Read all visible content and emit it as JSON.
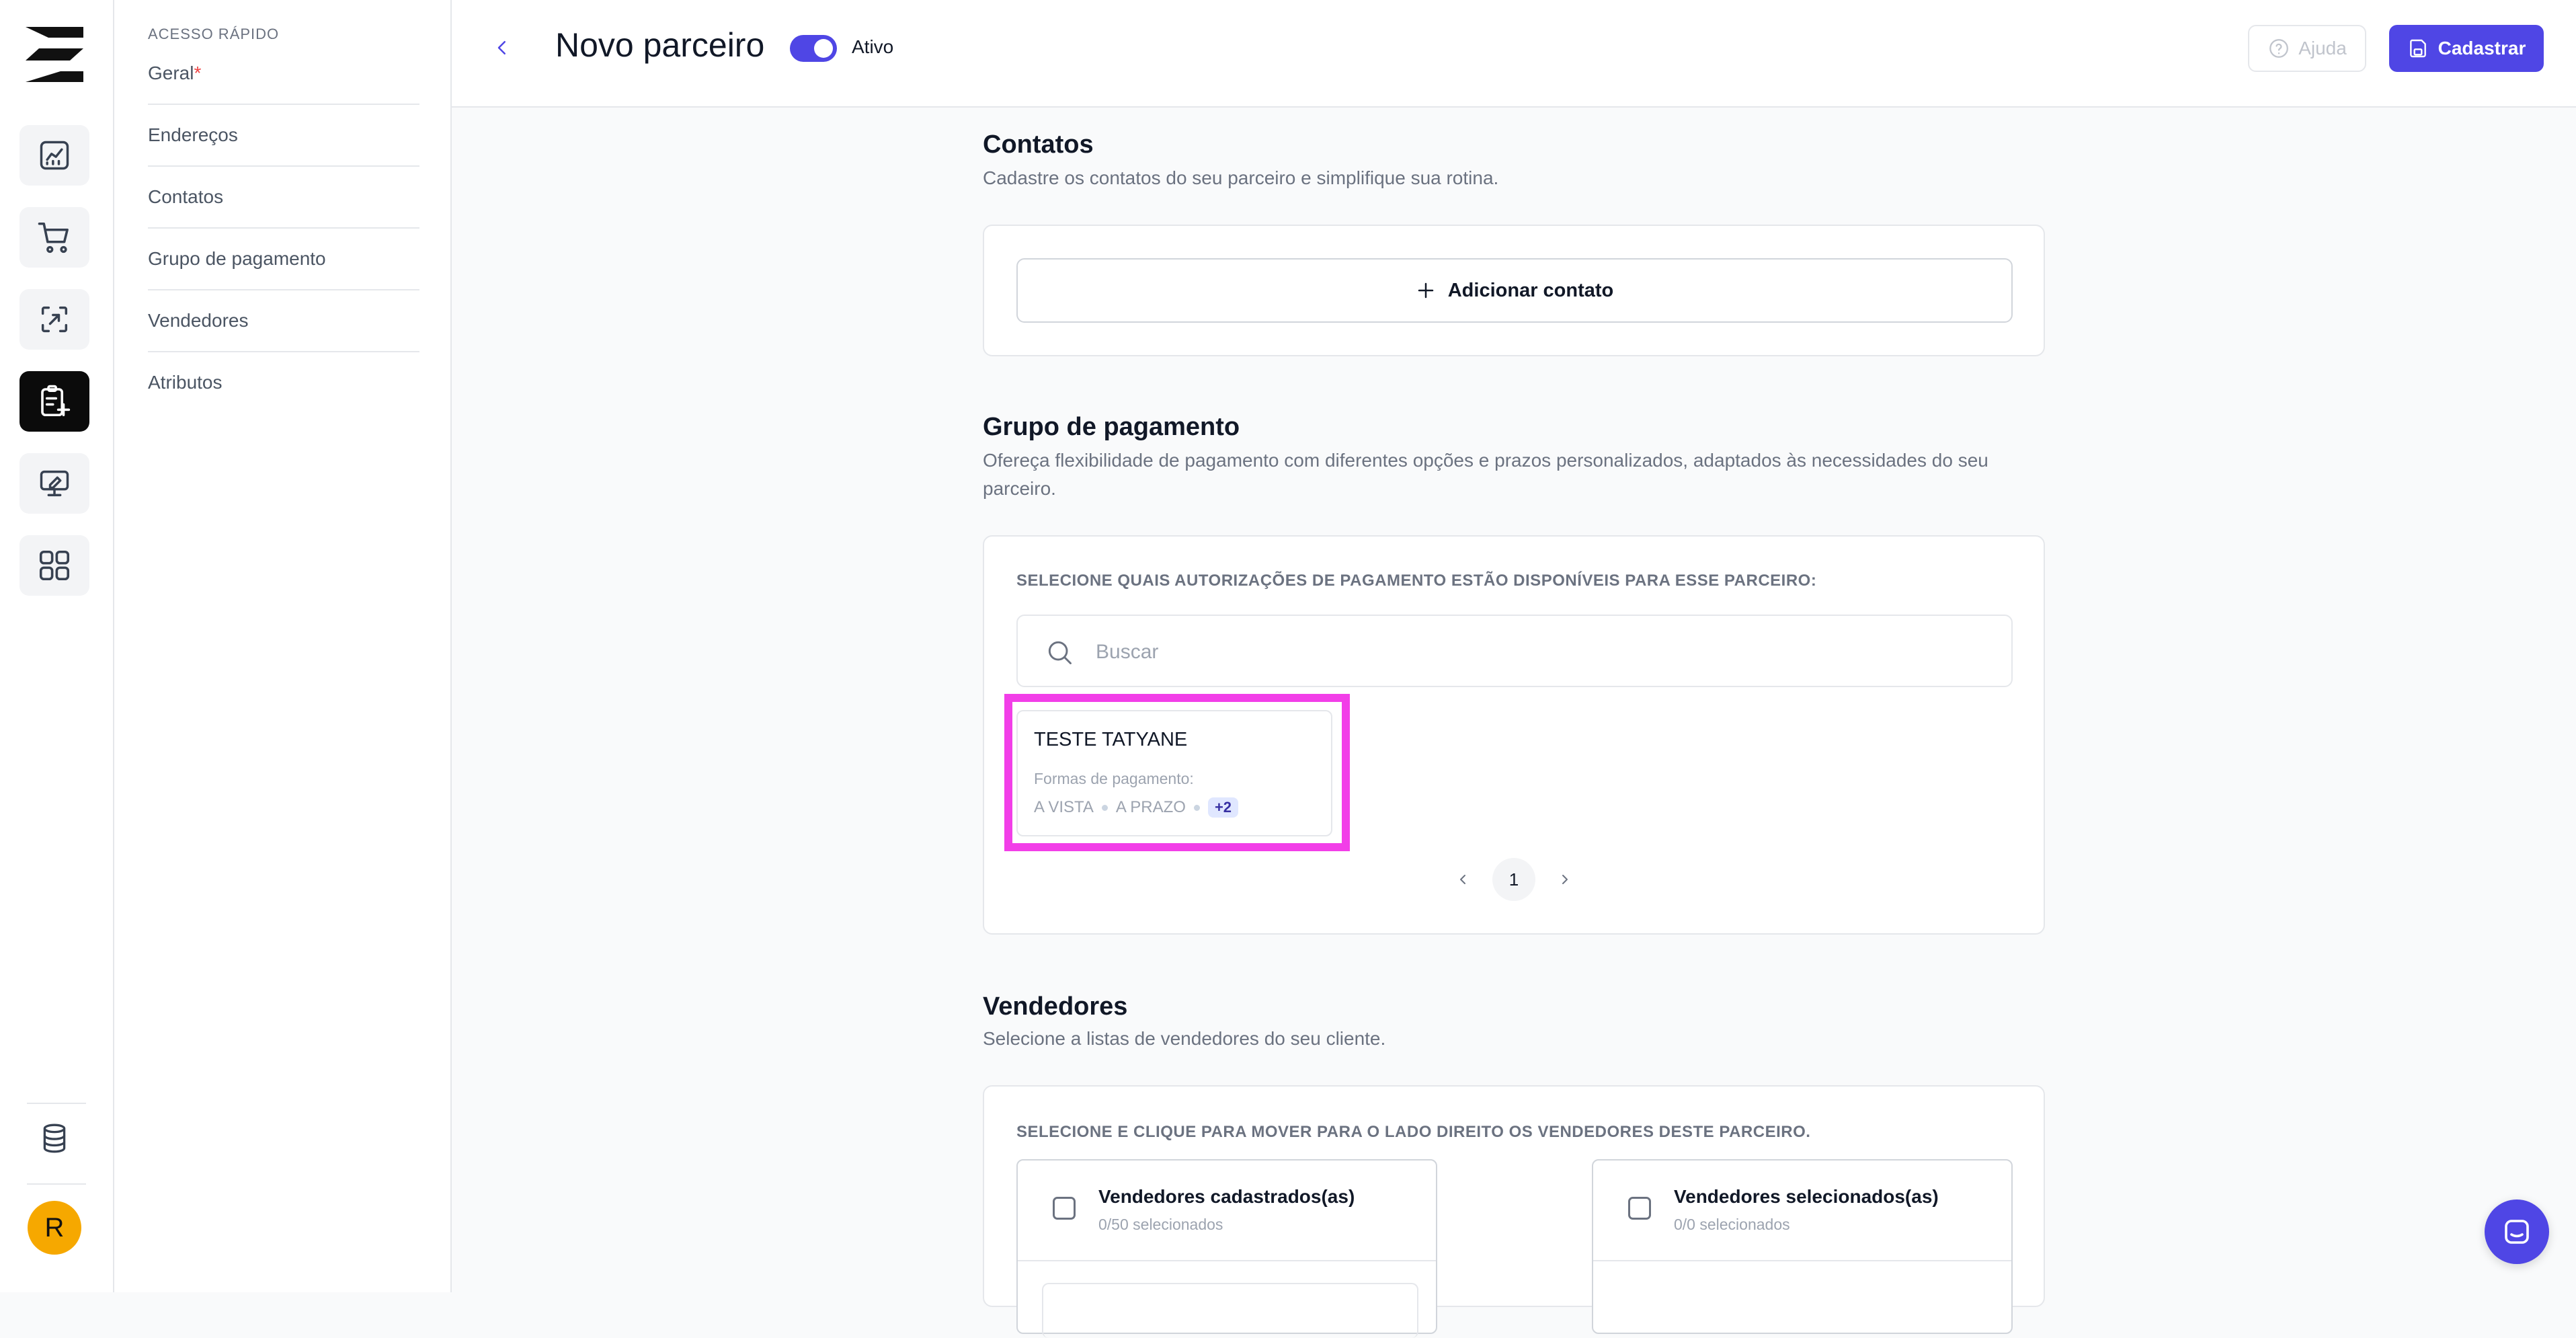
{
  "quick_access": {
    "header": "ACESSO RÁPIDO",
    "items": [
      {
        "label": "Geral",
        "required_mark": "*"
      },
      {
        "label": "Endereços"
      },
      {
        "label": "Contatos"
      },
      {
        "label": "Grupo de pagamento"
      },
      {
        "label": "Vendedores"
      },
      {
        "label": "Atributos"
      }
    ]
  },
  "rail": {
    "icons": [
      "dashboard-chart-icon",
      "cart-icon",
      "exchange-icon",
      "new-document-icon",
      "monitor-edit-icon",
      "apps-grid-icon"
    ],
    "active": "new-document-icon",
    "bottom_icon": "database-icon",
    "avatar_initial": "R",
    "avatar_color": "#f6a800"
  },
  "header": {
    "title": "Novo parceiro",
    "toggle_label": "Ativo",
    "toggle_on": true,
    "help_label": "Ajuda",
    "save_label": "Cadastrar",
    "accent_color": "#4f46e5"
  },
  "contacts": {
    "title": "Contatos",
    "subtitle": "Cadastre os contatos do seu parceiro e simplifique sua rotina.",
    "add_button": "Adicionar contato"
  },
  "payment": {
    "title": "Grupo de pagamento",
    "subtitle": "Ofereça flexibilidade de pagamento com diferentes opções e prazos personalizados, adaptados às necessidades do seu parceiro.",
    "instruction": "SELECIONE QUAIS AUTORIZAÇÕES DE PAGAMENTO ESTÃO DISPONÍVEIS PARA ESSE PARCEIRO:",
    "search_placeholder": "Buscar",
    "cards": [
      {
        "name": "TESTE TATYANE",
        "methods_label": "Formas de pagamento:",
        "methods": [
          "A VISTA",
          "A PRAZO"
        ],
        "more": "+2"
      }
    ],
    "page": "1",
    "highlight_color": "#f23ee8"
  },
  "sellers": {
    "title": "Vendedores",
    "subtitle": "Selecione a listas de vendedores do seu cliente.",
    "instruction": "SELECIONE E CLIQUE PARA MOVER PARA O LADO DIREITO OS VENDEDORES DESTE PARCEIRO.",
    "left_list": {
      "title": "Vendedores cadastrados(as)",
      "count": "0/50 selecionados"
    },
    "right_list": {
      "title": "Vendedores selecionados(as)",
      "count": "0/0 selecionados"
    }
  }
}
